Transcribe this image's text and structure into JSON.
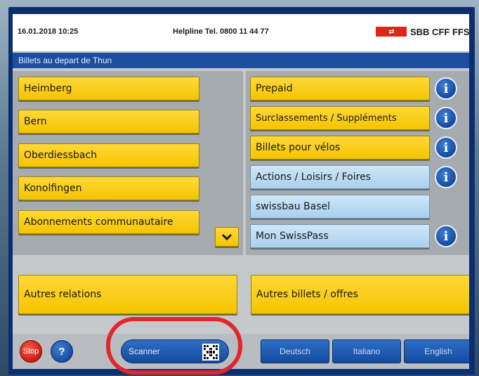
{
  "header": {
    "datetime": "16.01.2018 10:25",
    "helpline": "Helpline  Tel. 0800 11 44 77",
    "logo_text": "SBB CFF FFS"
  },
  "title": "Billets au depart de Thun",
  "destinations": [
    {
      "label": "Heimberg"
    },
    {
      "label": "Bern"
    },
    {
      "label": "Oberdiessbach"
    },
    {
      "label": "Konolfingen"
    },
    {
      "label": "Abonnements communautaire"
    }
  ],
  "offers": [
    {
      "label": "Prepaid",
      "style": "yellow",
      "info": true
    },
    {
      "label": "Surclassements / Suppléments",
      "style": "yellow",
      "info": true
    },
    {
      "label": "Billets pour vélos",
      "style": "yellow",
      "info": true
    },
    {
      "label": "Actions / Loisirs / Foires",
      "style": "blue",
      "info": true
    },
    {
      "label": "swissbau Basel",
      "style": "blue",
      "info": false
    },
    {
      "label": "Mon SwissPass",
      "style": "blue",
      "info": true
    }
  ],
  "info_symbol": "i",
  "main_actions": {
    "other_relations": "Autres relations",
    "other_offers": "Autres billets / offres"
  },
  "bottom": {
    "stop": "Stop",
    "help": "?",
    "scanner": "Scanner",
    "languages": [
      "Deutsch",
      "Italiano",
      "English"
    ]
  },
  "colors": {
    "accent_yellow": "#f5c400",
    "title_blue": "#1c4ea0",
    "light_blue": "#a8d0ee",
    "stop_red": "#c8160d",
    "highlight_red": "#e3262c"
  }
}
